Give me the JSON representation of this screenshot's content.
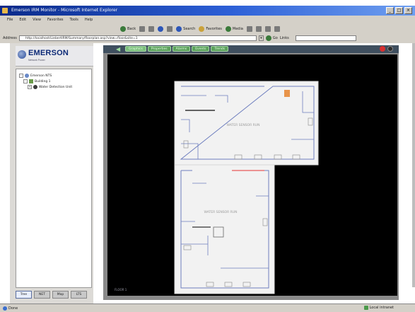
{
  "window": {
    "title": "Emerson IRM Monitor - Microsoft Internet Explorer",
    "controls": [
      "_",
      "□",
      "×"
    ]
  },
  "menu": [
    "File",
    "Edit",
    "View",
    "Favorites",
    "Tools",
    "Help"
  ],
  "toolbar": {
    "back_label": "Back",
    "search_label": "Search",
    "favorites_label": "Favorites",
    "media_label": "Media"
  },
  "address": {
    "label": "Address",
    "url": "http://localhost/LiebertIRM/Summary/floorplan.asp?view=floor&site=1",
    "go_label": "Go",
    "links_label": "Links"
  },
  "brand": {
    "name": "EMERSON",
    "subtitle": "Network Power"
  },
  "tree": {
    "items": [
      {
        "label": "Emerson NTS"
      },
      {
        "label": "Building 1"
      },
      {
        "label": "Water Detection Unit"
      }
    ]
  },
  "left_tabs": [
    "Tree",
    "NET",
    "Map",
    "LTS"
  ],
  "floor_tabs": [
    "Graphics",
    "Properties",
    "Alarms",
    "Events",
    "Trends"
  ],
  "floor_plan": {
    "zone_label": "WATER SENSOR RUN",
    "floor_label": "FLOOR 1"
  },
  "status": {
    "left": "Done",
    "zone": "Local intranet"
  },
  "colors": {
    "title_bar": "#0a2a8a",
    "tab_green": "#5ca25c",
    "canvas_bg": "#000000",
    "wall": "#6f7fbf",
    "sensor_cable": "#e85a5a",
    "brand_blue": "#0d2a77"
  }
}
